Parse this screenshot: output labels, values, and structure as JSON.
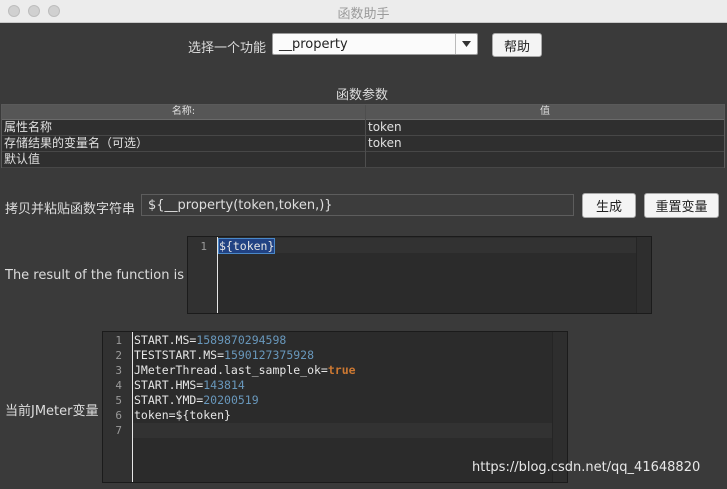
{
  "window": {
    "title": "函数助手"
  },
  "function_select": {
    "label": "选择一个功能",
    "value": "__property",
    "help_label": "帮助"
  },
  "params": {
    "heading": "函数参数",
    "columns": [
      "名称:",
      "值"
    ],
    "rows": [
      {
        "name": "属性名称",
        "value": "token"
      },
      {
        "name": "存储结果的变量名（可选）",
        "value": "token"
      },
      {
        "name": "默认值",
        "value": ""
      }
    ]
  },
  "copy_string": {
    "label": "拷贝并粘贴函数字符串",
    "value": "${__property(token,token,)}",
    "generate_label": "生成",
    "reset_label": "重置变量"
  },
  "result": {
    "label": "The result of the function is",
    "lines": [
      {
        "num": "1",
        "text": "${token}"
      }
    ]
  },
  "variables": {
    "label": "当前JMeter变量",
    "lines": [
      {
        "num": "1",
        "key": "START.MS=",
        "val": "1589870294598"
      },
      {
        "num": "2",
        "key": "TESTSTART.MS=",
        "val": "1590127375928"
      },
      {
        "num": "3",
        "key": "JMeterThread.last_sample_ok=",
        "val": "true"
      },
      {
        "num": "4",
        "key": "START.HMS=",
        "val": "143814"
      },
      {
        "num": "5",
        "key": "START.YMD=",
        "val": "20200519"
      },
      {
        "num": "6",
        "key": "token=${token}",
        "val": ""
      },
      {
        "num": "7",
        "key": "",
        "val": ""
      }
    ]
  },
  "watermark": "https://blog.csdn.net/qq_41648820",
  "colors": {
    "number": "#6897bb",
    "keyword": "#cc7832",
    "background": "#3a3a3a"
  }
}
